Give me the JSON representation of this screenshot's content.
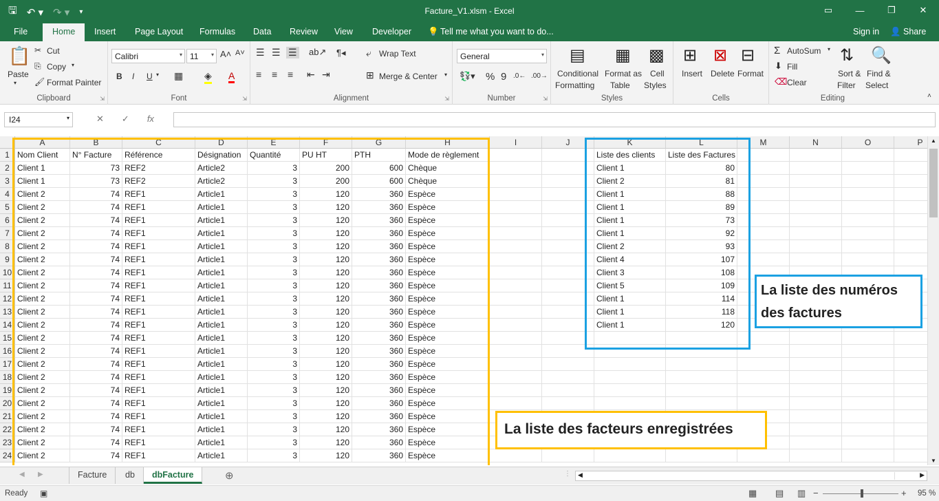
{
  "window": {
    "title": "Facture_V1.xlsm - Excel"
  },
  "tabs": {
    "file": "File",
    "home": "Home",
    "insert": "Insert",
    "page_layout": "Page Layout",
    "formulas": "Formulas",
    "data": "Data",
    "review": "Review",
    "view": "View",
    "developer": "Developer",
    "tell_me": "Tell me what you want to do...",
    "sign_in": "Sign in",
    "share": "Share"
  },
  "ribbon": {
    "clipboard": {
      "label": "Clipboard",
      "paste": "Paste",
      "cut": "Cut",
      "copy": "Copy",
      "format_painter": "Format Painter"
    },
    "font": {
      "label": "Font",
      "name": "Calibri",
      "size": "11",
      "bold": "B",
      "italic": "I",
      "underline": "U"
    },
    "alignment": {
      "label": "Alignment",
      "wrap": "Wrap Text",
      "merge": "Merge & Center"
    },
    "number": {
      "label": "Number",
      "format": "General",
      "percent": "%",
      "comma": "9"
    },
    "styles": {
      "label": "Styles",
      "conditional": "Conditional",
      "formatting": "Formatting",
      "format_as": "Format as",
      "table": "Table",
      "cell": "Cell",
      "cell_styles": "Styles"
    },
    "cells": {
      "label": "Cells",
      "insert": "Insert",
      "delete": "Delete",
      "format": "Format"
    },
    "editing": {
      "label": "Editing",
      "autosum": "AutoSum",
      "fill": "Fill",
      "clear": "Clear",
      "sort": "Sort &",
      "filter": "Filter",
      "find": "Find &",
      "select": "Select"
    }
  },
  "formula_bar": {
    "name_box": "I24",
    "fx": "fx",
    "content": ""
  },
  "sheet": {
    "columns": [
      "A",
      "B",
      "C",
      "D",
      "E",
      "F",
      "G",
      "H",
      "I",
      "J",
      "K",
      "L",
      "M",
      "N",
      "O",
      "P"
    ],
    "rows": [
      "1",
      "2",
      "3",
      "4",
      "5",
      "6",
      "7",
      "8",
      "9",
      "10",
      "11",
      "12",
      "13",
      "14",
      "15",
      "16",
      "17",
      "18",
      "19",
      "20",
      "21",
      "22",
      "23",
      "24"
    ],
    "header": [
      "Nom Client",
      "N° Facture",
      "Référence",
      "Désignation",
      "Quantité",
      "PU HT",
      "PTH",
      "Mode de règlement"
    ],
    "data": [
      [
        "Client 1",
        "73",
        "REF2",
        "Article2",
        "3",
        "200",
        "600",
        "Chèque"
      ],
      [
        "Client 1",
        "73",
        "REF2",
        "Article2",
        "3",
        "200",
        "600",
        "Chèque"
      ],
      [
        "Client 2",
        "74",
        "REF1",
        "Article1",
        "3",
        "120",
        "360",
        "Espèce"
      ],
      [
        "Client 2",
        "74",
        "REF1",
        "Article1",
        "3",
        "120",
        "360",
        "Espèce"
      ],
      [
        "Client 2",
        "74",
        "REF1",
        "Article1",
        "3",
        "120",
        "360",
        "Espèce"
      ],
      [
        "Client 2",
        "74",
        "REF1",
        "Article1",
        "3",
        "120",
        "360",
        "Espèce"
      ],
      [
        "Client 2",
        "74",
        "REF1",
        "Article1",
        "3",
        "120",
        "360",
        "Espèce"
      ],
      [
        "Client 2",
        "74",
        "REF1",
        "Article1",
        "3",
        "120",
        "360",
        "Espèce"
      ],
      [
        "Client 2",
        "74",
        "REF1",
        "Article1",
        "3",
        "120",
        "360",
        "Espèce"
      ],
      [
        "Client 2",
        "74",
        "REF1",
        "Article1",
        "3",
        "120",
        "360",
        "Espèce"
      ],
      [
        "Client 2",
        "74",
        "REF1",
        "Article1",
        "3",
        "120",
        "360",
        "Espèce"
      ],
      [
        "Client 2",
        "74",
        "REF1",
        "Article1",
        "3",
        "120",
        "360",
        "Espèce"
      ],
      [
        "Client 2",
        "74",
        "REF1",
        "Article1",
        "3",
        "120",
        "360",
        "Espèce"
      ],
      [
        "Client 2",
        "74",
        "REF1",
        "Article1",
        "3",
        "120",
        "360",
        "Espèce"
      ],
      [
        "Client 2",
        "74",
        "REF1",
        "Article1",
        "3",
        "120",
        "360",
        "Espèce"
      ],
      [
        "Client 2",
        "74",
        "REF1",
        "Article1",
        "3",
        "120",
        "360",
        "Espèce"
      ],
      [
        "Client 2",
        "74",
        "REF1",
        "Article1",
        "3",
        "120",
        "360",
        "Espèce"
      ],
      [
        "Client 2",
        "74",
        "REF1",
        "Article1",
        "3",
        "120",
        "360",
        "Espèce"
      ],
      [
        "Client 2",
        "74",
        "REF1",
        "Article1",
        "3",
        "120",
        "360",
        "Espèce"
      ],
      [
        "Client 2",
        "74",
        "REF1",
        "Article1",
        "3",
        "120",
        "360",
        "Espèce"
      ],
      [
        "Client 2",
        "74",
        "REF1",
        "Article1",
        "3",
        "120",
        "360",
        "Espèce"
      ],
      [
        "Client 2",
        "74",
        "REF1",
        "Article1",
        "3",
        "120",
        "360",
        "Espèce"
      ],
      [
        "Client 2",
        "74",
        "REF1",
        "Article1",
        "3",
        "120",
        "360",
        "Espèce"
      ]
    ],
    "list_header": [
      "Liste des clients",
      "Liste des Factures"
    ],
    "list": [
      [
        "Client 1",
        "80"
      ],
      [
        "Client 2",
        "81"
      ],
      [
        "Client 1",
        "88"
      ],
      [
        "Client 1",
        "89"
      ],
      [
        "Client 1",
        "73"
      ],
      [
        "Client 1",
        "92"
      ],
      [
        "Client 2",
        "93"
      ],
      [
        "Client 4",
        "107"
      ],
      [
        "Client 3",
        "108"
      ],
      [
        "Client 5",
        "109"
      ],
      [
        "Client 1",
        "114"
      ],
      [
        "Client 1",
        "118"
      ],
      [
        "Client 1",
        "120"
      ]
    ]
  },
  "callouts": {
    "invoices_numbers": "La liste des numéros des factures",
    "recorded": "La liste des facteurs enregistrées"
  },
  "sheet_tabs": [
    "Facture",
    "db",
    "dbFacture"
  ],
  "active_sheet": "dbFacture",
  "status": {
    "ready": "Ready",
    "zoom": "95 %"
  },
  "colors": {
    "brand": "#217346",
    "yellow_box": "#FFC000",
    "blue_box": "#1BA1E2"
  }
}
